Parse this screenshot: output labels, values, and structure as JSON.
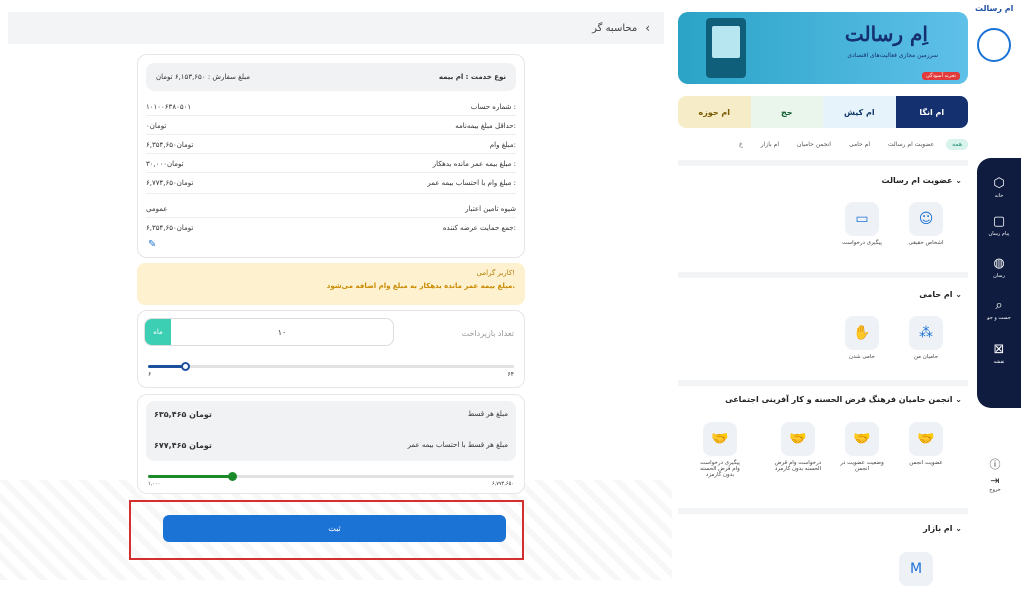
{
  "calc": {
    "title": "محاسبه گر",
    "back_icon": "chevron-left-icon",
    "summary": {
      "service_label": "نوع خدمت : ام بیمه",
      "order_amount": "مبلغ سفارش : ۶,۱۵۳,۶۵۰ تومان"
    },
    "rows": [
      {
        "label": "شماره حساب :",
        "value": "۱۰۱۰۰۶۳۸۰۵۰۱"
      },
      {
        "label": "حداقل مبلغ بیمه‌نامه:",
        "value": "۰تومان"
      },
      {
        "label": "مبلغ وام:",
        "value": "۶,۳۵۴,۶۵۰تومان"
      },
      {
        "label": "مبلغ بیمه عمر مانده بدهکار :",
        "value": "۳۰,۰۰۰تومان"
      },
      {
        "label": "مبلغ وام با احتساب بیمه عمر :",
        "value": "۶,۷۷۴,۶۵۰تومان"
      },
      {
        "label": "شیوه تامین اعتبار",
        "value": "عمومی"
      },
      {
        "label": "جمع حمایت عرضه کننده:",
        "value": "۶,۳۵۴,۶۵۰تومان"
      }
    ],
    "alert": {
      "title": "کاربر گرامی!",
      "message": "مبلغ بیمه عمر مانده بدهکار به مبلغ وام اضافه می‌شود."
    },
    "installments": {
      "label": "تعداد بازپرداخت",
      "value": "۱۰",
      "unit": "ماه",
      "min": "۶",
      "max": "۶۴",
      "slider_fraction": 0.1
    },
    "payment": {
      "per_installment_label": "مبلغ هر قسط",
      "per_installment_value": "۶۳۵,۴۶۵ تومان",
      "with_insurance_label": "مبلغ هر قسط با احتساب بیمه عمر",
      "with_insurance_value": "۶۷۷,۴۶۵ تومان",
      "range_min": "۱,۰۰۰",
      "range_max": "۶,۷۷۴,۶۵۰",
      "slider_fraction": 0.23
    },
    "submit_label": "ثبت"
  },
  "app": {
    "top_title": "ام رسالت",
    "banner": {
      "logo": "اِم رسالت",
      "subtitle": "سرزمین مجازی فعالیت‌های اقتصادی",
      "tag": "تجربه آسودگی"
    },
    "service_tabs": [
      {
        "label": "ام حوزه",
        "bg": "#f6ecc8",
        "color": "#7a5a00"
      },
      {
        "label": "حج",
        "bg": "#eaf5ec",
        "color": "#0b5a2e"
      },
      {
        "label": "ام کیش",
        "bg": "#e6f3fb",
        "color": "#123a6a"
      },
      {
        "label": "ام انگا",
        "bg": "#14306f",
        "color": "#ffffff"
      }
    ],
    "quick_links": [
      "همه",
      "عضویت ام رسالت",
      "ام حامی",
      "انجمن حامیان",
      "ام بازار",
      "خ"
    ],
    "sections": {
      "membership": {
        "title": "عضویت ام رسالت",
        "items": [
          "اشخاص حقیقی",
          "پیگیری درخواست"
        ]
      },
      "hami": {
        "title": "ام حامی",
        "items": [
          "حامیان من",
          "حامی شدن"
        ]
      },
      "association": {
        "title": "انجمن حامیان فرهنگ قرض الحسنه و کار آفرینی اجتماعی",
        "items": [
          "عضویت انجمن",
          "وضعیت عضویت در انجمن",
          "درخواست وام قرض الحسنه بدون کارمزد",
          "پیگیری درخواست وام قرض الحسنه بدون کارمزد"
        ]
      },
      "bazaar": {
        "title": "ام بازار"
      }
    },
    "side_nav": [
      "خانه",
      "پیام رسان",
      "رسان",
      "جست و جو",
      "نقشه"
    ],
    "bottom_nav": [
      "خروج"
    ]
  }
}
